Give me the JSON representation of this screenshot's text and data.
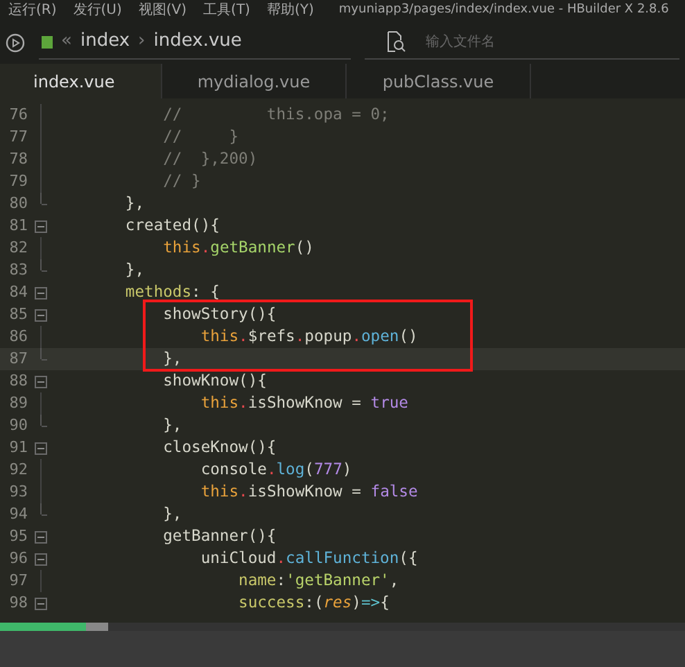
{
  "menu": [
    "运行(R)",
    "发行(U)",
    "视图(V)",
    "工具(T)",
    "帮助(Y)"
  ],
  "window": {
    "title": "myuniapp3/pages/index/index.vue - HBuilder X 2.8.6"
  },
  "breadcrumb": {
    "back": "«",
    "separator": "›",
    "items": [
      "index",
      "index.vue"
    ]
  },
  "file_search": {
    "placeholder": "输入文件名"
  },
  "tabs": [
    {
      "label": "index.vue",
      "selected": true
    },
    {
      "label": "mydialog.vue",
      "selected": false
    },
    {
      "label": "pubClass.vue",
      "selected": false
    }
  ],
  "lines": [
    {
      "number": "76",
      "foldable": false,
      "block_end": false,
      "current": false,
      "outlined": false,
      "tokens": [
        {
          "kind": "comment",
          "text": "            //         this.opa = 0;"
        }
      ]
    },
    {
      "number": "77",
      "foldable": false,
      "block_end": false,
      "current": false,
      "outlined": false,
      "tokens": [
        {
          "kind": "comment",
          "text": "            //     }"
        }
      ]
    },
    {
      "number": "78",
      "foldable": false,
      "block_end": false,
      "current": false,
      "outlined": false,
      "tokens": [
        {
          "kind": "comment",
          "text": "            //  },200)"
        }
      ]
    },
    {
      "number": "79",
      "foldable": false,
      "block_end": false,
      "current": false,
      "outlined": false,
      "tokens": [
        {
          "kind": "comment",
          "text": "            // }"
        }
      ]
    },
    {
      "number": "80",
      "foldable": false,
      "block_end": true,
      "current": false,
      "outlined": false,
      "tokens": [
        {
          "kind": "plain",
          "text": "        },"
        }
      ]
    },
    {
      "number": "81",
      "foldable": true,
      "block_end": false,
      "current": false,
      "outlined": false,
      "tokens": [
        {
          "kind": "plain",
          "text": "        created(){"
        }
      ]
    },
    {
      "number": "82",
      "foldable": false,
      "block_end": false,
      "current": false,
      "outlined": false,
      "tokens": [
        {
          "kind": "this",
          "text": "            this"
        },
        {
          "kind": "member_method",
          "text": ".getBanner"
        },
        {
          "kind": "plain",
          "text": "()"
        }
      ]
    },
    {
      "number": "83",
      "foldable": false,
      "block_end": true,
      "current": false,
      "outlined": false,
      "tokens": [
        {
          "kind": "plain",
          "text": "        },"
        }
      ]
    },
    {
      "number": "84",
      "foldable": true,
      "block_end": false,
      "current": false,
      "outlined": false,
      "tokens": [
        {
          "kind": "key",
          "text": "        methods"
        },
        {
          "kind": "plain",
          "text": ": {"
        }
      ]
    },
    {
      "number": "85",
      "foldable": true,
      "block_end": false,
      "current": false,
      "outlined": true,
      "tokens": [
        {
          "kind": "plain",
          "text": "            showStory(){"
        }
      ]
    },
    {
      "number": "86",
      "foldable": false,
      "block_end": false,
      "current": false,
      "outlined": true,
      "tokens": [
        {
          "kind": "this",
          "text": "                this"
        },
        {
          "kind": "member",
          "text": ".$refs"
        },
        {
          "kind": "member",
          "text": ".popup"
        },
        {
          "kind": "member_call",
          "text": ".open"
        },
        {
          "kind": "plain",
          "text": "()"
        }
      ]
    },
    {
      "number": "87",
      "foldable": false,
      "block_end": true,
      "current": true,
      "outlined": true,
      "tokens": [
        {
          "kind": "plain",
          "text": "            },"
        }
      ]
    },
    {
      "number": "88",
      "foldable": true,
      "block_end": false,
      "current": false,
      "outlined": false,
      "tokens": [
        {
          "kind": "plain",
          "text": "            showKnow(){"
        }
      ]
    },
    {
      "number": "89",
      "foldable": false,
      "block_end": false,
      "current": false,
      "outlined": false,
      "tokens": [
        {
          "kind": "this",
          "text": "                this"
        },
        {
          "kind": "member",
          "text": ".isShowKnow = "
        },
        {
          "kind": "literal",
          "text": "true"
        }
      ]
    },
    {
      "number": "90",
      "foldable": false,
      "block_end": true,
      "current": false,
      "outlined": false,
      "tokens": [
        {
          "kind": "plain",
          "text": "            },"
        }
      ]
    },
    {
      "number": "91",
      "foldable": true,
      "block_end": false,
      "current": false,
      "outlined": false,
      "tokens": [
        {
          "kind": "plain",
          "text": "            closeKnow(){"
        }
      ]
    },
    {
      "number": "92",
      "foldable": false,
      "block_end": false,
      "current": false,
      "outlined": false,
      "tokens": [
        {
          "kind": "plain",
          "text": "                console"
        },
        {
          "kind": "member_call",
          "text": ".log"
        },
        {
          "kind": "plain",
          "text": "("
        },
        {
          "kind": "literal",
          "text": "777"
        },
        {
          "kind": "plain",
          "text": ")"
        }
      ]
    },
    {
      "number": "93",
      "foldable": false,
      "block_end": false,
      "current": false,
      "outlined": false,
      "tokens": [
        {
          "kind": "this",
          "text": "                this"
        },
        {
          "kind": "member",
          "text": ".isShowKnow = "
        },
        {
          "kind": "literal",
          "text": "false"
        }
      ]
    },
    {
      "number": "94",
      "foldable": false,
      "block_end": true,
      "current": false,
      "outlined": false,
      "tokens": [
        {
          "kind": "plain",
          "text": "            },"
        }
      ]
    },
    {
      "number": "95",
      "foldable": true,
      "block_end": false,
      "current": false,
      "outlined": false,
      "tokens": [
        {
          "kind": "plain",
          "text": "            getBanner(){"
        }
      ]
    },
    {
      "number": "96",
      "foldable": true,
      "block_end": false,
      "current": false,
      "outlined": false,
      "tokens": [
        {
          "kind": "plain",
          "text": "                uniCloud"
        },
        {
          "kind": "member_call",
          "text": ".callFunction"
        },
        {
          "kind": "plain",
          "text": "({"
        }
      ]
    },
    {
      "number": "97",
      "foldable": false,
      "block_end": false,
      "current": false,
      "outlined": false,
      "tokens": [
        {
          "kind": "key",
          "text": "                    name"
        },
        {
          "kind": "plain",
          "text": ":"
        },
        {
          "kind": "string",
          "text": "'getBanner'"
        },
        {
          "kind": "plain",
          "text": ","
        }
      ]
    },
    {
      "number": "98",
      "foldable": true,
      "block_end": false,
      "current": false,
      "outlined": false,
      "tokens": [
        {
          "kind": "key",
          "text": "                    success"
        },
        {
          "kind": "plain",
          "text": ":("
        },
        {
          "kind": "param",
          "text": "res"
        },
        {
          "kind": "plain",
          "text": ")"
        },
        {
          "kind": "arrow",
          "text": "=>"
        },
        {
          "kind": "plain",
          "text": "{"
        }
      ]
    }
  ]
}
